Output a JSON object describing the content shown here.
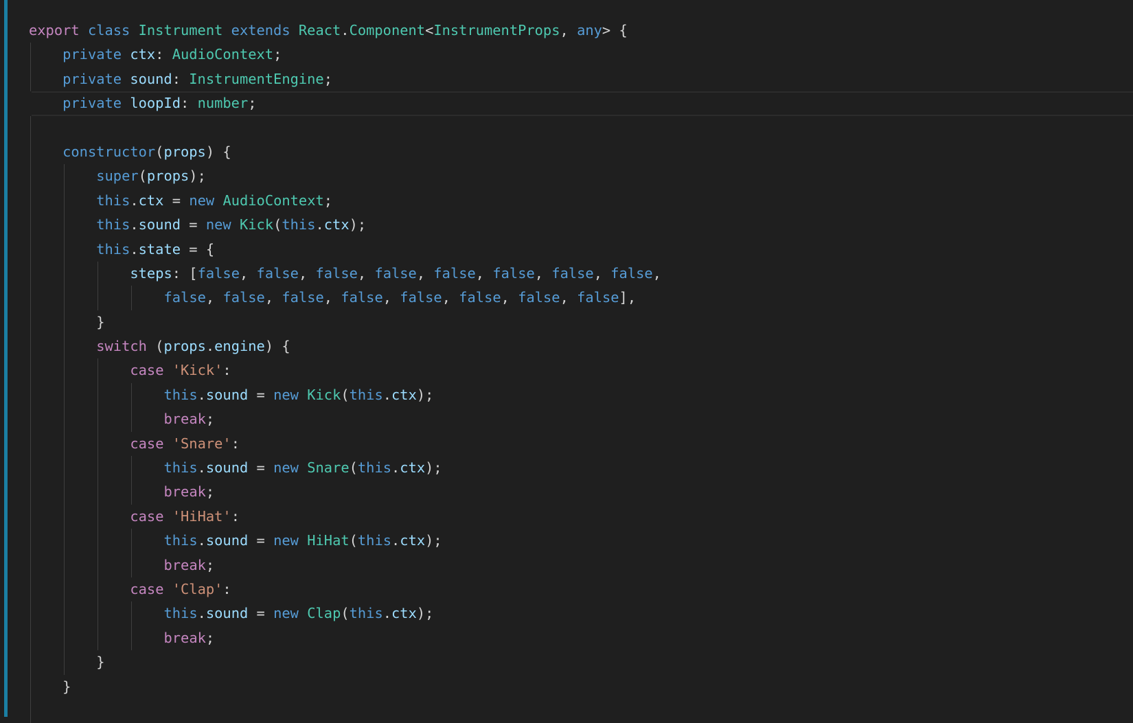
{
  "editor": {
    "current_line": 4,
    "colors": {
      "background": "#1f1f1f",
      "keyword": "#c586c0",
      "storage": "#569cd6",
      "type": "#4ec9b0",
      "variable": "#9cdcfe",
      "string": "#ce9178",
      "punctuation": "#d4d4d4",
      "accent": "#1b7fa3"
    },
    "lines": [
      {
        "indent": 0,
        "tokens": [
          [
            "k",
            "export"
          ],
          [
            "p",
            " "
          ],
          [
            "b",
            "class"
          ],
          [
            "p",
            " "
          ],
          [
            "t",
            "Instrument"
          ],
          [
            "p",
            " "
          ],
          [
            "b",
            "extends"
          ],
          [
            "p",
            " "
          ],
          [
            "t",
            "React"
          ],
          [
            "p",
            "."
          ],
          [
            "t",
            "Component"
          ],
          [
            "p",
            "<"
          ],
          [
            "t",
            "InstrumentProps"
          ],
          [
            "p",
            ", "
          ],
          [
            "b",
            "any"
          ],
          [
            "p",
            "> {"
          ]
        ]
      },
      {
        "indent": 1,
        "tokens": [
          [
            "b",
            "private"
          ],
          [
            "p",
            " "
          ],
          [
            "v",
            "ctx"
          ],
          [
            "p",
            ": "
          ],
          [
            "t",
            "AudioContext"
          ],
          [
            "p",
            ";"
          ]
        ]
      },
      {
        "indent": 1,
        "tokens": [
          [
            "b",
            "private"
          ],
          [
            "p",
            " "
          ],
          [
            "v",
            "sound"
          ],
          [
            "p",
            ": "
          ],
          [
            "t",
            "InstrumentEngine"
          ],
          [
            "p",
            ";"
          ]
        ]
      },
      {
        "indent": 1,
        "tokens": [
          [
            "b",
            "private"
          ],
          [
            "p",
            " "
          ],
          [
            "v",
            "loopId"
          ],
          [
            "p",
            ": "
          ],
          [
            "t",
            "number"
          ],
          [
            "p",
            ";"
          ]
        ]
      },
      {
        "indent": 1,
        "tokens": []
      },
      {
        "indent": 1,
        "tokens": [
          [
            "b",
            "constructor"
          ],
          [
            "p",
            "("
          ],
          [
            "v",
            "props"
          ],
          [
            "p",
            ") {"
          ]
        ]
      },
      {
        "indent": 2,
        "tokens": [
          [
            "b",
            "super"
          ],
          [
            "p",
            "("
          ],
          [
            "v",
            "props"
          ],
          [
            "p",
            ");"
          ]
        ]
      },
      {
        "indent": 2,
        "tokens": [
          [
            "b",
            "this"
          ],
          [
            "p",
            "."
          ],
          [
            "v",
            "ctx"
          ],
          [
            "p",
            " = "
          ],
          [
            "b",
            "new"
          ],
          [
            "p",
            " "
          ],
          [
            "t",
            "AudioContext"
          ],
          [
            "p",
            ";"
          ]
        ]
      },
      {
        "indent": 2,
        "tokens": [
          [
            "b",
            "this"
          ],
          [
            "p",
            "."
          ],
          [
            "v",
            "sound"
          ],
          [
            "p",
            " = "
          ],
          [
            "b",
            "new"
          ],
          [
            "p",
            " "
          ],
          [
            "t",
            "Kick"
          ],
          [
            "p",
            "("
          ],
          [
            "b",
            "this"
          ],
          [
            "p",
            "."
          ],
          [
            "v",
            "ctx"
          ],
          [
            "p",
            ");"
          ]
        ]
      },
      {
        "indent": 2,
        "tokens": [
          [
            "b",
            "this"
          ],
          [
            "p",
            "."
          ],
          [
            "v",
            "state"
          ],
          [
            "p",
            " = {"
          ]
        ]
      },
      {
        "indent": 3,
        "tokens": [
          [
            "v",
            "steps"
          ],
          [
            "p",
            ": ["
          ],
          [
            "b",
            "false"
          ],
          [
            "p",
            ", "
          ],
          [
            "b",
            "false"
          ],
          [
            "p",
            ", "
          ],
          [
            "b",
            "false"
          ],
          [
            "p",
            ", "
          ],
          [
            "b",
            "false"
          ],
          [
            "p",
            ", "
          ],
          [
            "b",
            "false"
          ],
          [
            "p",
            ", "
          ],
          [
            "b",
            "false"
          ],
          [
            "p",
            ", "
          ],
          [
            "b",
            "false"
          ],
          [
            "p",
            ", "
          ],
          [
            "b",
            "false"
          ],
          [
            "p",
            ","
          ]
        ]
      },
      {
        "indent": 4,
        "tokens": [
          [
            "b",
            "false"
          ],
          [
            "p",
            ", "
          ],
          [
            "b",
            "false"
          ],
          [
            "p",
            ", "
          ],
          [
            "b",
            "false"
          ],
          [
            "p",
            ", "
          ],
          [
            "b",
            "false"
          ],
          [
            "p",
            ", "
          ],
          [
            "b",
            "false"
          ],
          [
            "p",
            ", "
          ],
          [
            "b",
            "false"
          ],
          [
            "p",
            ", "
          ],
          [
            "b",
            "false"
          ],
          [
            "p",
            ", "
          ],
          [
            "b",
            "false"
          ],
          [
            "p",
            "],"
          ]
        ]
      },
      {
        "indent": 2,
        "tokens": [
          [
            "p",
            "}"
          ]
        ]
      },
      {
        "indent": 2,
        "tokens": [
          [
            "k",
            "switch"
          ],
          [
            "p",
            " ("
          ],
          [
            "v",
            "props"
          ],
          [
            "p",
            "."
          ],
          [
            "v",
            "engine"
          ],
          [
            "p",
            ") {"
          ]
        ]
      },
      {
        "indent": 3,
        "tokens": [
          [
            "k",
            "case"
          ],
          [
            "p",
            " "
          ],
          [
            "s",
            "'Kick'"
          ],
          [
            "p",
            ":"
          ]
        ]
      },
      {
        "indent": 4,
        "tokens": [
          [
            "b",
            "this"
          ],
          [
            "p",
            "."
          ],
          [
            "v",
            "sound"
          ],
          [
            "p",
            " = "
          ],
          [
            "b",
            "new"
          ],
          [
            "p",
            " "
          ],
          [
            "t",
            "Kick"
          ],
          [
            "p",
            "("
          ],
          [
            "b",
            "this"
          ],
          [
            "p",
            "."
          ],
          [
            "v",
            "ctx"
          ],
          [
            "p",
            ");"
          ]
        ]
      },
      {
        "indent": 4,
        "tokens": [
          [
            "k",
            "break"
          ],
          [
            "p",
            ";"
          ]
        ]
      },
      {
        "indent": 3,
        "tokens": [
          [
            "k",
            "case"
          ],
          [
            "p",
            " "
          ],
          [
            "s",
            "'Snare'"
          ],
          [
            "p",
            ":"
          ]
        ]
      },
      {
        "indent": 4,
        "tokens": [
          [
            "b",
            "this"
          ],
          [
            "p",
            "."
          ],
          [
            "v",
            "sound"
          ],
          [
            "p",
            " = "
          ],
          [
            "b",
            "new"
          ],
          [
            "p",
            " "
          ],
          [
            "t",
            "Snare"
          ],
          [
            "p",
            "("
          ],
          [
            "b",
            "this"
          ],
          [
            "p",
            "."
          ],
          [
            "v",
            "ctx"
          ],
          [
            "p",
            ");"
          ]
        ]
      },
      {
        "indent": 4,
        "tokens": [
          [
            "k",
            "break"
          ],
          [
            "p",
            ";"
          ]
        ]
      },
      {
        "indent": 3,
        "tokens": [
          [
            "k",
            "case"
          ],
          [
            "p",
            " "
          ],
          [
            "s",
            "'HiHat'"
          ],
          [
            "p",
            ":"
          ]
        ]
      },
      {
        "indent": 4,
        "tokens": [
          [
            "b",
            "this"
          ],
          [
            "p",
            "."
          ],
          [
            "v",
            "sound"
          ],
          [
            "p",
            " = "
          ],
          [
            "b",
            "new"
          ],
          [
            "p",
            " "
          ],
          [
            "t",
            "HiHat"
          ],
          [
            "p",
            "("
          ],
          [
            "b",
            "this"
          ],
          [
            "p",
            "."
          ],
          [
            "v",
            "ctx"
          ],
          [
            "p",
            ");"
          ]
        ]
      },
      {
        "indent": 4,
        "tokens": [
          [
            "k",
            "break"
          ],
          [
            "p",
            ";"
          ]
        ]
      },
      {
        "indent": 3,
        "tokens": [
          [
            "k",
            "case"
          ],
          [
            "p",
            " "
          ],
          [
            "s",
            "'Clap'"
          ],
          [
            "p",
            ":"
          ]
        ]
      },
      {
        "indent": 4,
        "tokens": [
          [
            "b",
            "this"
          ],
          [
            "p",
            "."
          ],
          [
            "v",
            "sound"
          ],
          [
            "p",
            " = "
          ],
          [
            "b",
            "new"
          ],
          [
            "p",
            " "
          ],
          [
            "t",
            "Clap"
          ],
          [
            "p",
            "("
          ],
          [
            "b",
            "this"
          ],
          [
            "p",
            "."
          ],
          [
            "v",
            "ctx"
          ],
          [
            "p",
            ");"
          ]
        ]
      },
      {
        "indent": 4,
        "tokens": [
          [
            "k",
            "break"
          ],
          [
            "p",
            ";"
          ]
        ]
      },
      {
        "indent": 2,
        "tokens": [
          [
            "p",
            "}"
          ]
        ]
      },
      {
        "indent": 1,
        "tokens": [
          [
            "p",
            "}"
          ]
        ]
      },
      {
        "indent": 1,
        "tokens": []
      }
    ]
  }
}
